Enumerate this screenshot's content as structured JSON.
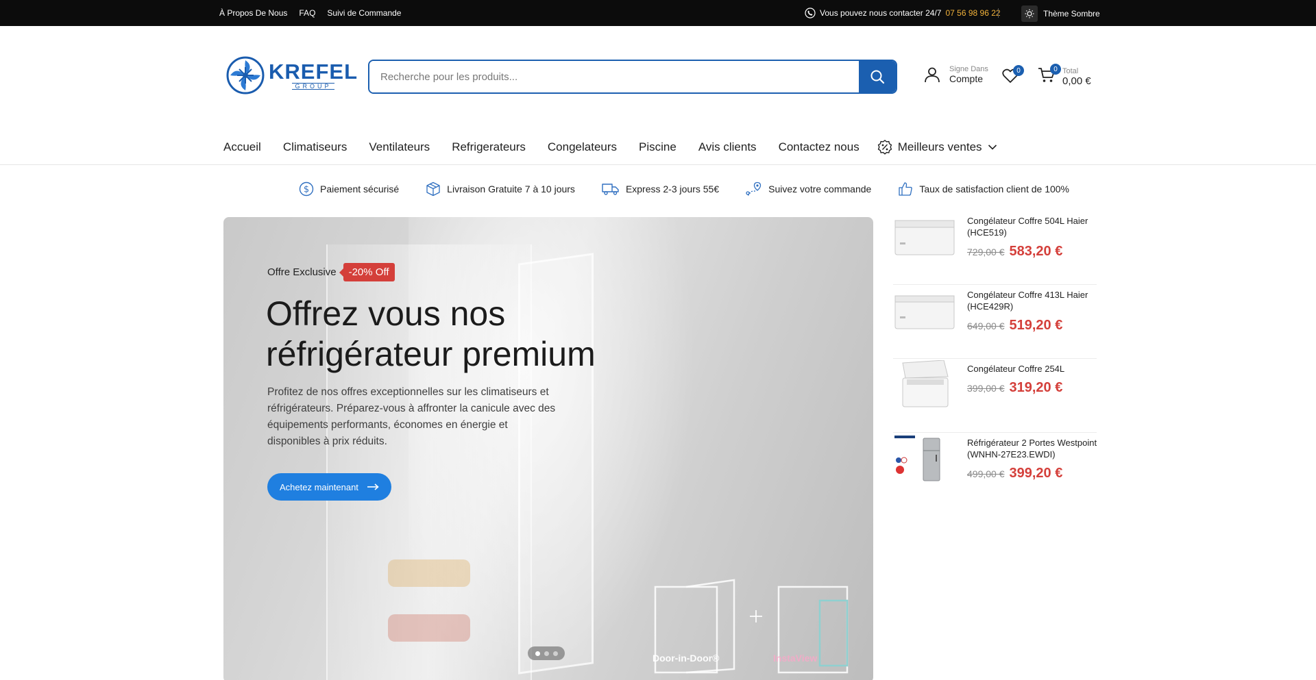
{
  "topbar": {
    "links": [
      "À Propos De Nous",
      "FAQ",
      "Suivi de Commande"
    ],
    "contact_text": "Vous pouvez nous contacter 24/7",
    "phone": "07 56 98 96 22",
    "theme_label": "Thème Sombre"
  },
  "logo": {
    "main": "KREFEL",
    "sub": "GROUP"
  },
  "search": {
    "placeholder": "Recherche pour les produits..."
  },
  "account": {
    "small": "Signe Dans",
    "big": "Compte"
  },
  "wishlist": {
    "count": "0"
  },
  "cart": {
    "count": "0",
    "small": "Total",
    "total": "0,00 €"
  },
  "nav": {
    "items": [
      "Accueil",
      "Climatiseurs",
      "Ventilateurs",
      "Refrigerateurs",
      "Congelateurs",
      "Piscine",
      "Avis clients",
      "Contactez nous"
    ],
    "best_sellers": "Meilleurs ventes"
  },
  "features": [
    {
      "icon": "dollar-icon",
      "label": "Paiement sécurisé"
    },
    {
      "icon": "box-icon",
      "label": "Livraison Gratuite 7 à 10 jours"
    },
    {
      "icon": "truck-icon",
      "label": "Express 2-3 jours 55€"
    },
    {
      "icon": "location-icon",
      "label": "Suivez votre commande"
    },
    {
      "icon": "thumbs-up-icon",
      "label": "Taux de satisfaction client de 100%"
    }
  ],
  "hero": {
    "eyebrow": "Offre Exclusive",
    "tag": "-20% Off",
    "title_line1": "Offrez vous nos",
    "title_line2": "réfrigérateur premium",
    "description": "Profitez de nos offres exceptionnelles sur les climatiseurs et réfrigérateurs. Préparez-vous à affronter la canicule avec des équipements performants, économes en énergie et disponibles à prix réduits.",
    "cta": "Achetez maintenant",
    "image_label_left": "Door-in-Door®",
    "image_label_right": "InstaView",
    "slides": 3,
    "active_slide": 1
  },
  "products": [
    {
      "name": "Congélateur Coffre 504L Haier (HCE519)",
      "old_price": "729,00 €",
      "price": "583,20 €"
    },
    {
      "name": "Congélateur Coffre 413L Haier (HCE429R)",
      "old_price": "649,00 €",
      "price": "519,20 €"
    },
    {
      "name": "Congélateur Coffre 254L",
      "old_price": "399,00 €",
      "price": "319,20 €"
    },
    {
      "name": "Réfrigérateur 2 Portes Westpoint (WNHN-27E23.EWDI)",
      "old_price": "499,00 €",
      "price": "399,20 €"
    }
  ],
  "colors": {
    "brand_blue": "#1b5fb0",
    "cta_blue": "#1f7fe0",
    "sale_red": "#d43f3a",
    "phone_accent": "#f2b23a"
  }
}
